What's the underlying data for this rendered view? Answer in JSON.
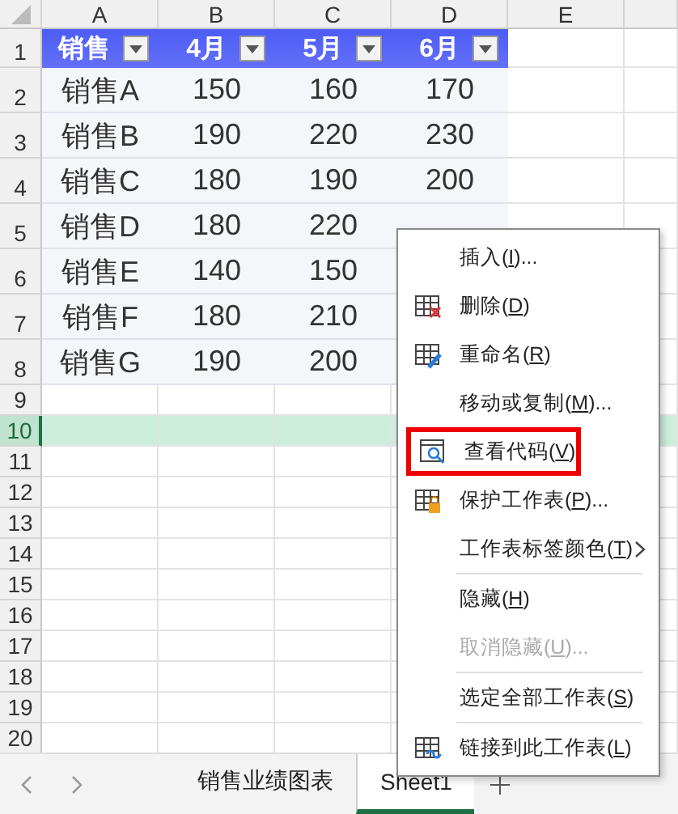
{
  "column_headers": [
    "A",
    "B",
    "C",
    "D",
    "E"
  ],
  "header_row": [
    "销售",
    "4月",
    "5月",
    "6月"
  ],
  "rows": [
    [
      "销售A",
      "150",
      "160",
      "170"
    ],
    [
      "销售B",
      "190",
      "220",
      "230"
    ],
    [
      "销售C",
      "180",
      "190",
      "200"
    ],
    [
      "销售D",
      "180",
      "220"
    ],
    [
      "销售E",
      "140",
      "150"
    ],
    [
      "销售F",
      "180",
      "210"
    ],
    [
      "销售G",
      "190",
      "200"
    ]
  ],
  "row_headers": [
    {
      "label": "1",
      "selected": false
    },
    {
      "label": "2",
      "selected": false
    },
    {
      "label": "3",
      "selected": false
    },
    {
      "label": "4",
      "selected": false
    },
    {
      "label": "5",
      "selected": false
    },
    {
      "label": "6",
      "selected": false
    },
    {
      "label": "7",
      "selected": false
    },
    {
      "label": "8",
      "selected": false
    },
    {
      "label": "9",
      "selected": false
    },
    {
      "label": "10",
      "selected": true
    },
    {
      "label": "11",
      "selected": false
    },
    {
      "label": "12",
      "selected": false
    },
    {
      "label": "13",
      "selected": false
    },
    {
      "label": "14",
      "selected": false
    },
    {
      "label": "15",
      "selected": false
    },
    {
      "label": "16",
      "selected": false
    },
    {
      "label": "17",
      "selected": false
    },
    {
      "label": "18",
      "selected": false
    },
    {
      "label": "19",
      "selected": false
    },
    {
      "label": "20",
      "selected": false
    }
  ],
  "context_menu": [
    {
      "kind": "plain",
      "label": "插入(",
      "key": "I",
      "tail": ")...",
      "disabled": false,
      "highlighted": false
    },
    {
      "kind": "delete",
      "label": "删除(",
      "key": "D",
      "tail": ")",
      "disabled": false,
      "highlighted": false
    },
    {
      "kind": "rename",
      "label": "重命名(",
      "key": "R",
      "tail": ")",
      "disabled": false,
      "highlighted": false
    },
    {
      "kind": "plain",
      "label": "移动或复制(",
      "key": "M",
      "tail": ")...",
      "disabled": false,
      "highlighted": false
    },
    {
      "kind": "code",
      "label": "查看代码(",
      "key": "V",
      "tail": ")",
      "disabled": false,
      "highlighted": true
    },
    {
      "kind": "protect",
      "label": "保护工作表(",
      "key": "P",
      "tail": ")...",
      "disabled": false,
      "highlighted": false
    },
    {
      "kind": "submenu",
      "label": "工作表标签颜色(",
      "key": "T",
      "tail": ")",
      "disabled": false,
      "highlighted": false
    },
    {
      "kind": "separator"
    },
    {
      "kind": "plain",
      "label": "隐藏(",
      "key": "H",
      "tail": ")",
      "disabled": false,
      "highlighted": false
    },
    {
      "kind": "plain",
      "label": "取消隐藏(",
      "key": "U",
      "tail": ")...",
      "disabled": true,
      "highlighted": false
    },
    {
      "kind": "separator"
    },
    {
      "kind": "plain",
      "label": "选定全部工作表(",
      "key": "S",
      "tail": ")",
      "disabled": false,
      "highlighted": false
    },
    {
      "kind": "separator"
    },
    {
      "kind": "link",
      "label": "链接到此工作表(",
      "key": "L",
      "tail": ")",
      "disabled": false,
      "highlighted": false
    }
  ],
  "sheet_tabs": [
    {
      "label": "销售业绩图表",
      "selected": false
    },
    {
      "label": "Sheet1",
      "selected": true
    }
  ]
}
